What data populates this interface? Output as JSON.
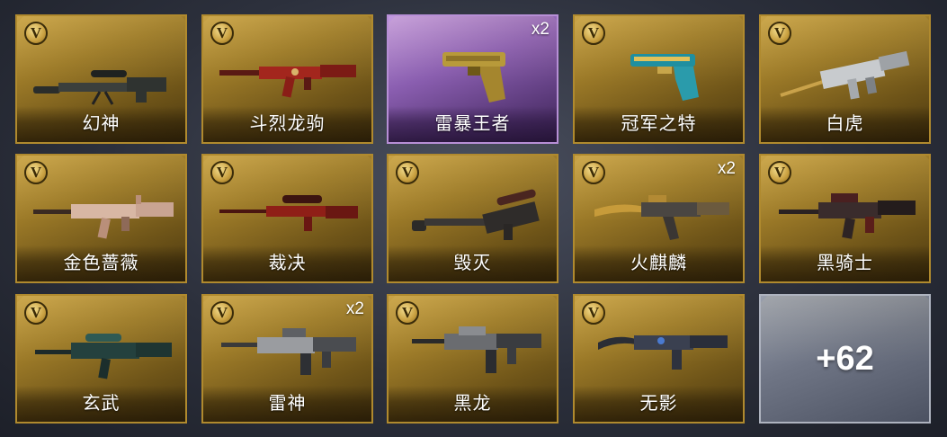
{
  "items": [
    {
      "name": "幻神",
      "count": "",
      "style": "gold",
      "icon": "sniper-rifle-icon",
      "badge": "V"
    },
    {
      "name": "斗烈龙驹",
      "count": "",
      "style": "gold",
      "icon": "assault-rifle-icon",
      "badge": "V"
    },
    {
      "name": "雷暴王者",
      "count": "x2",
      "style": "purple",
      "icon": "pistol-icon",
      "badge": ""
    },
    {
      "name": "冠军之特",
      "count": "",
      "style": "gold",
      "icon": "pistol-icon",
      "badge": "V"
    },
    {
      "name": "白虎",
      "count": "",
      "style": "gold",
      "icon": "smg-icon",
      "badge": "V"
    },
    {
      "name": "金色蔷薇",
      "count": "",
      "style": "gold",
      "icon": "assault-rifle-icon",
      "badge": "V"
    },
    {
      "name": "裁决",
      "count": "",
      "style": "gold",
      "icon": "sniper-rifle-icon",
      "badge": "V"
    },
    {
      "name": "毁灭",
      "count": "",
      "style": "gold",
      "icon": "sniper-rifle-icon",
      "badge": "V"
    },
    {
      "name": "火麒麟",
      "count": "x2",
      "style": "gold",
      "icon": "assault-rifle-icon",
      "badge": "V"
    },
    {
      "name": "黑骑士",
      "count": "",
      "style": "gold",
      "icon": "assault-rifle-icon",
      "badge": "V"
    },
    {
      "name": "玄武",
      "count": "",
      "style": "gold",
      "icon": "assault-rifle-icon",
      "badge": "V"
    },
    {
      "name": "雷神",
      "count": "x2",
      "style": "gold",
      "icon": "assault-rifle-icon",
      "badge": "V"
    },
    {
      "name": "黑龙",
      "count": "",
      "style": "gold",
      "icon": "assault-rifle-icon",
      "badge": "V"
    },
    {
      "name": "无影",
      "count": "",
      "style": "gold",
      "icon": "assault-rifle-icon",
      "badge": "V"
    }
  ],
  "more": {
    "label": "+62"
  }
}
